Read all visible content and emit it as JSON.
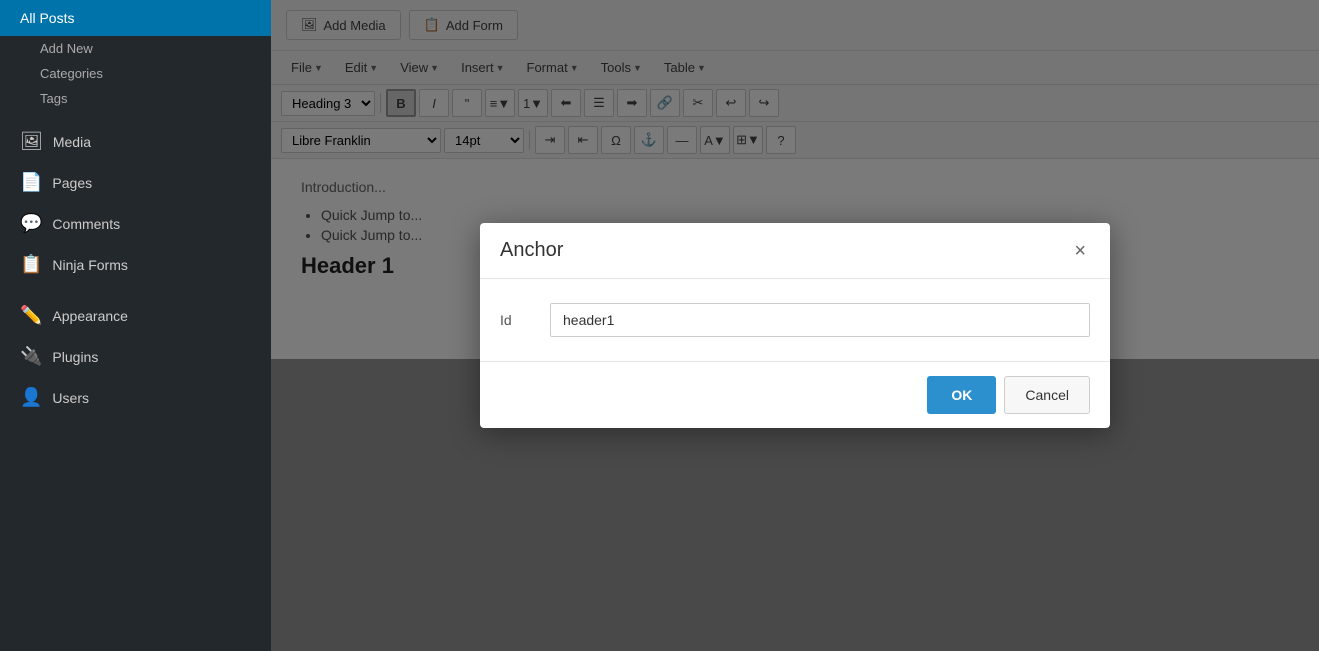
{
  "sidebar": {
    "items": [
      {
        "id": "all-posts",
        "label": "All Posts",
        "icon": "",
        "active": true
      },
      {
        "id": "add-new",
        "label": "Add New",
        "icon": ""
      },
      {
        "id": "categories",
        "label": "Categories",
        "icon": ""
      },
      {
        "id": "tags",
        "label": "Tags",
        "icon": ""
      }
    ],
    "sections": [
      {
        "id": "media",
        "label": "Media",
        "icon": "🖼"
      },
      {
        "id": "pages",
        "label": "Pages",
        "icon": "📄"
      },
      {
        "id": "comments",
        "label": "Comments",
        "icon": "💬"
      },
      {
        "id": "ninja-forms",
        "label": "Ninja Forms",
        "icon": "📋"
      },
      {
        "id": "appearance",
        "label": "Appearance",
        "icon": "🎨"
      },
      {
        "id": "plugins",
        "label": "Plugins",
        "icon": "🔌"
      },
      {
        "id": "users",
        "label": "Users",
        "icon": "👤"
      }
    ]
  },
  "toolbar": {
    "add_media_label": "Add Media",
    "add_form_label": "Add Form",
    "menus": [
      {
        "id": "file",
        "label": "File"
      },
      {
        "id": "edit",
        "label": "Edit"
      },
      {
        "id": "view",
        "label": "View"
      },
      {
        "id": "insert",
        "label": "Insert"
      },
      {
        "id": "format",
        "label": "Format"
      },
      {
        "id": "tools",
        "label": "Tools"
      },
      {
        "id": "table",
        "label": "Table"
      }
    ],
    "heading_select": "Heading 3",
    "font_select": "Libre Franklin",
    "font_size": "14pt"
  },
  "editor": {
    "intro_text": "Introduction...",
    "bullet1": "Quick Jump to...",
    "bullet2": "Quick Jump to...",
    "header1": "Header 1"
  },
  "modal": {
    "title": "Anchor",
    "close_label": "×",
    "id_label": "Id",
    "id_value": "header1",
    "ok_label": "OK",
    "cancel_label": "Cancel"
  }
}
